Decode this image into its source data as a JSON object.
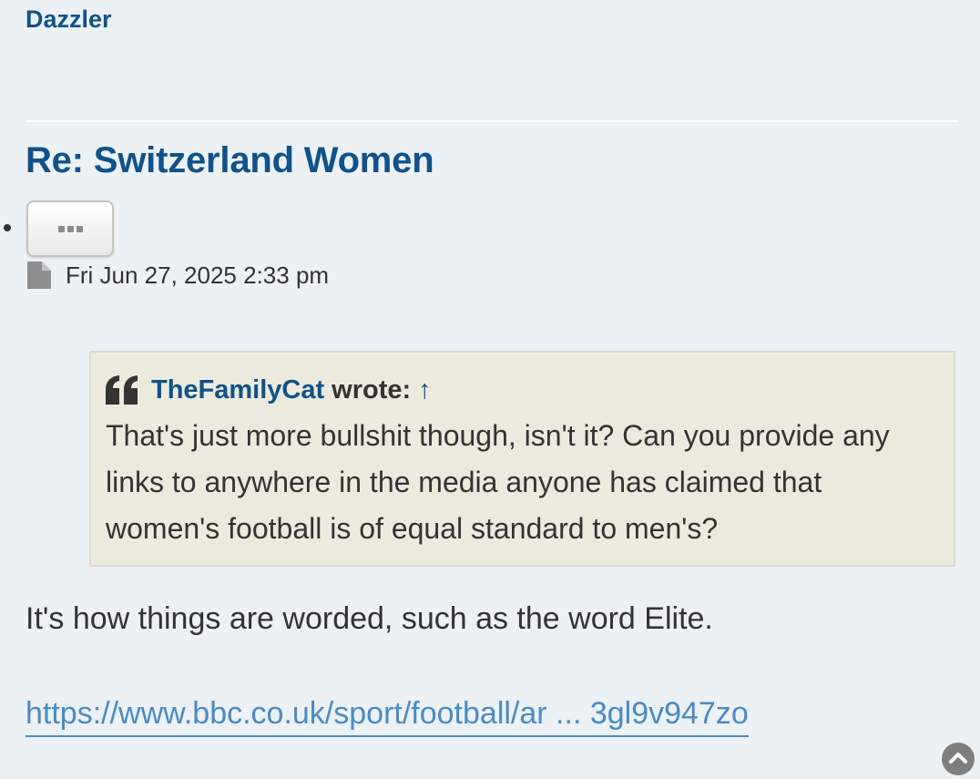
{
  "poster": {
    "username": "Dazzler"
  },
  "post": {
    "title": "Re: Switzerland Women",
    "date": "Fri Jun 27, 2025 2:33 pm"
  },
  "quote": {
    "author": "TheFamilyCat",
    "wrote_label": "wrote:",
    "jump_arrow": "↑",
    "text": "That's just more bullshit though, isn't it? Can you provide any links to anywhere in the media anyone has claimed that women's football is of equal standard to men's?"
  },
  "reply": {
    "text": "It's how things are worded, such as the word Elite.",
    "link_text": "https://www.bbc.co.uk/sport/football/ar ... 3gl9v947zo"
  },
  "icons": {
    "post_actions": "ellipsis-icon",
    "post_date": "file-icon",
    "quote": "quote-icon",
    "back_to_top": "chevron-up-circle-icon"
  },
  "colors": {
    "background": "#ecf1f5",
    "link_dark": "#105289",
    "link_light": "#4a8bc2",
    "quote_background": "#ebeadd",
    "text": "#333333"
  }
}
